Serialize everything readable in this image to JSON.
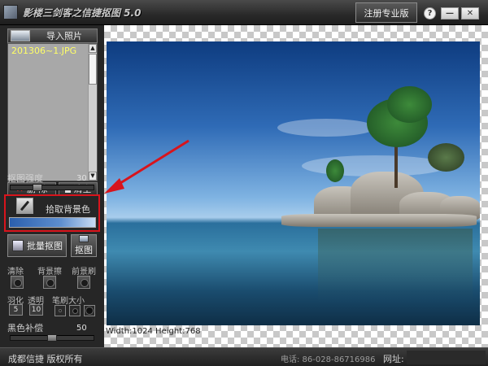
{
  "titlebar": {
    "title": "影楼三剑客之信捷抠图  5.0",
    "register_label": "注册专业版",
    "help_label": "?",
    "min_label": "—",
    "close_label": "✕"
  },
  "left_panel": {
    "import_label": "导入照片",
    "files": [
      "201306~1.JPG"
    ],
    "delete_label": "删 除",
    "clear_label": "清空",
    "strength_label": "抠图强度",
    "strength_value": "30",
    "strength_fraction": 0.3,
    "pick_bg_label": "拾取背景色",
    "batch_label": "批量抠图",
    "cut_label": "抠图",
    "tools": {
      "clear_label": "清除",
      "bg_brush_label": "背景擦",
      "fg_brush_label": "前景刷"
    },
    "feather_label": "羽化",
    "feather_value": "5",
    "transparency_label": "透明",
    "transparency_value": "10",
    "brush_size_label": "笔刷大小",
    "black_comp_label": "黑色补偿",
    "black_comp_value": "50",
    "black_comp_fraction": 0.5
  },
  "canvas": {
    "size_text": "Width:1024  Height:768"
  },
  "statusbar": {
    "company": "成都信捷  版权所有",
    "phone": "电话: 86-028-86716986",
    "address_label": "网址:"
  },
  "colors": {
    "highlight": "#d8141c",
    "file_text": "#ffff66"
  }
}
